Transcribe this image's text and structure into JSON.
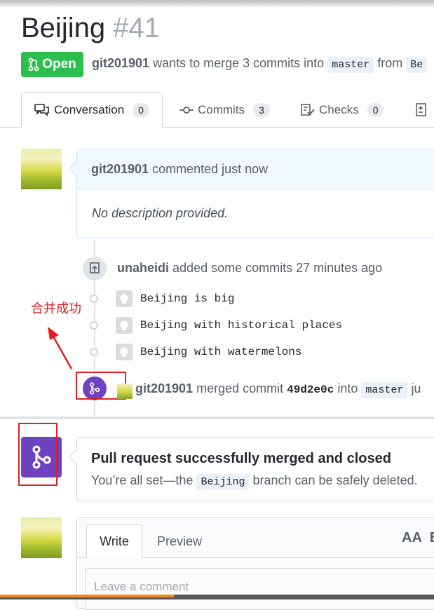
{
  "pr": {
    "title": "Beijing",
    "number": "#41",
    "status": "Open",
    "author": "git201901",
    "summary": "wants to merge 3 commits into",
    "base_branch": "master",
    "from_label": "from",
    "head_branch_partial": "Be"
  },
  "tabs": [
    {
      "label": "Conversation",
      "count": "0",
      "icon": "comment-discussion-icon"
    },
    {
      "label": "Commits",
      "count": "3",
      "icon": "git-commit-icon"
    },
    {
      "label": "Checks",
      "count": "0",
      "icon": "checklist-icon"
    }
  ],
  "comment": {
    "author": "git201901",
    "action": "commented just now",
    "body": "No description provided."
  },
  "push_event": {
    "user": "unaheidi",
    "text": "added some commits 27 minutes ago"
  },
  "commits": [
    {
      "message": "Beijing is big"
    },
    {
      "message": "Beijing with historical places"
    },
    {
      "message": "Beijing with watermelons"
    }
  ],
  "merge_event": {
    "user": "git201901",
    "text_before": "merged commit",
    "sha": "49d2e0c",
    "into": "into",
    "branch": "master",
    "trailing": "ju"
  },
  "annotation": {
    "text": "合并成功",
    "color": "#e02020"
  },
  "merged": {
    "title": "Pull request successfully merged and closed",
    "sub_before": "You’re all set—the",
    "branch": "Beijing",
    "sub_after": "branch can be safely deleted."
  },
  "editor": {
    "tab_write": "Write",
    "tab_preview": "Preview",
    "toolbar_text_size": "AA",
    "toolbar_bold": "B",
    "placeholder": "Leave a comment"
  },
  "video_progress": 0.4,
  "colors": {
    "open_green": "#2cbe4e",
    "merged_purple": "#6f42c1",
    "progress_orange": "#f28b24"
  }
}
